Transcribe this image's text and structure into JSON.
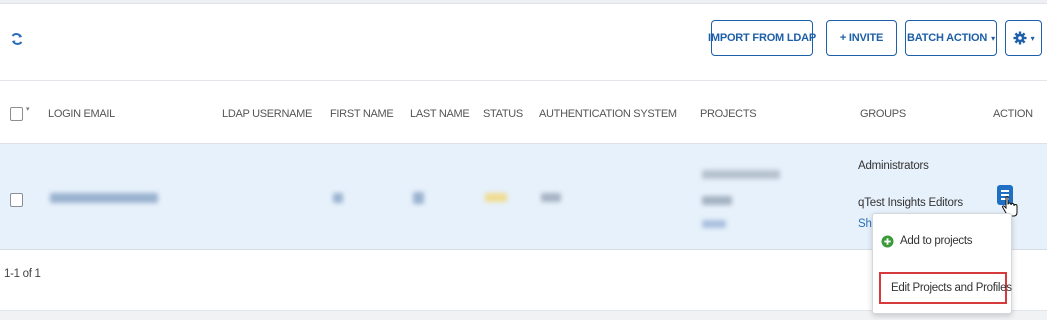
{
  "toolbar": {
    "refresh_icon": "refresh-icon",
    "import_ldap_label": "IMPORT FROM LDAP",
    "invite_label": "+ INVITE",
    "batch_action_label": "BATCH ACTION",
    "batch_action_caret": "▾",
    "settings_icon": "gear-icon",
    "settings_caret": "▾",
    "accent_color": "#1d5fa8"
  },
  "table": {
    "select_all_caret": "▾",
    "columns": [
      "LOGIN EMAIL",
      "LDAP USERNAME",
      "FIRST NAME",
      "LAST NAME",
      "STATUS",
      "AUTHENTICATION SYSTEM",
      "PROJECTS",
      "GROUPS",
      "ACTION"
    ],
    "row": {
      "groups": [
        "Administrators",
        "qTest Insights Editors"
      ],
      "groups_more": "Sho",
      "selected_row_color": "#e7f1fb"
    }
  },
  "pagination": {
    "range": "1-1 of 1"
  },
  "action_menu": {
    "items": [
      {
        "label": "Add to projects",
        "icon": "plus-circle-icon",
        "icon_color": "#3a9a3a"
      },
      {
        "label": "Edit Projects and Profiles",
        "icon": "pencil-icon",
        "icon_color": "#1f6fc4",
        "highlighted": true
      }
    ],
    "highlight_color": "#d63a3a"
  }
}
